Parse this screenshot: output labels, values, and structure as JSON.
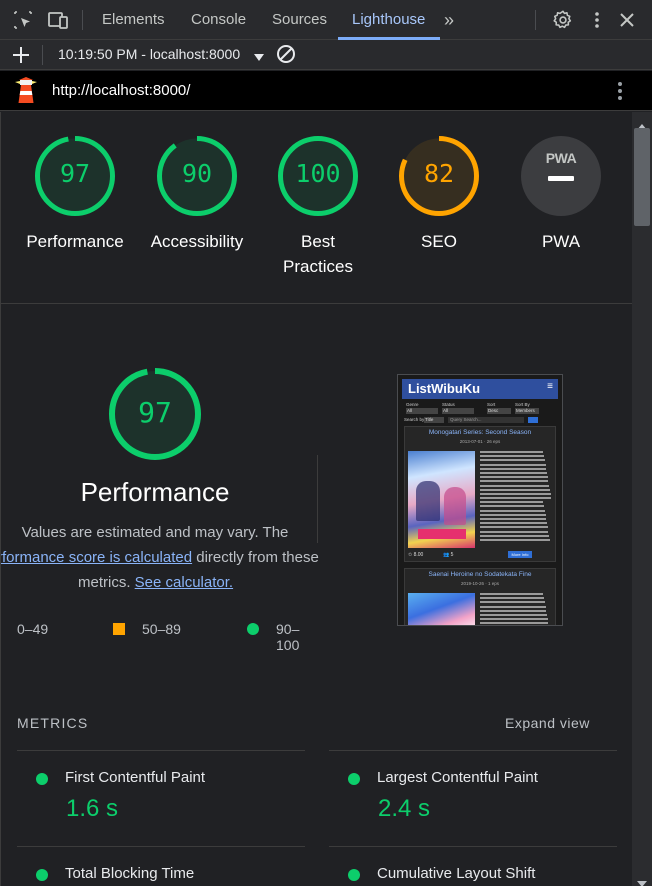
{
  "devtools": {
    "tabs": [
      {
        "label": "Elements"
      },
      {
        "label": "Console"
      },
      {
        "label": "Sources"
      },
      {
        "label": "Lighthouse"
      }
    ],
    "more_tabs": "»"
  },
  "toolbar": {
    "report_selector": "10:19:50 PM - localhost:8000"
  },
  "urlbar": {
    "url": "http://localhost:8000/"
  },
  "colors": {
    "pass": "#0cce6b",
    "average": "#ffa400",
    "fail": "#ff4e42",
    "accent": "#7cacf8"
  },
  "summary_gauges": [
    {
      "label": "Performance",
      "score": "97",
      "status": "pass"
    },
    {
      "label": "Accessibility",
      "score": "90",
      "status": "pass"
    },
    {
      "label": "Best Practices",
      "score": "100",
      "status": "pass"
    },
    {
      "label": "SEO",
      "score": "82",
      "status": "average"
    },
    {
      "label": "PWA",
      "score": "",
      "status": "pwa"
    }
  ],
  "performance": {
    "score": "97",
    "title": "Performance",
    "desc_line1": "Values are estimated and may vary. The",
    "desc_link1": "rformance score is calculated",
    "desc_mid": " directly from these",
    "desc_line3": "metrics. ",
    "desc_link2": "See calculator.",
    "legend": [
      {
        "range": "0–49"
      },
      {
        "range": "50–89"
      },
      {
        "range": "90–100"
      }
    ]
  },
  "screenshot": {
    "site_title": "ListWibuKu",
    "filters": [
      {
        "label": "Genre",
        "value": "All"
      },
      {
        "label": "Status",
        "value": "All"
      },
      {
        "label": "Sort",
        "value": "Desc"
      },
      {
        "label": "Sort By",
        "value": "Members"
      }
    ],
    "search_by": "Search by",
    "search_by_value": "Title",
    "query_placeholder": "Query Search...",
    "cards": [
      {
        "title": "Monogatari Series: Second Season",
        "meta": "2013-07-01 · 26 eps",
        "rating": "8.00",
        "members": "5",
        "button": "More Info"
      },
      {
        "title": "Saenai Heroine no Sodatekata Fine",
        "meta": "2019-10-26 · 1 eps"
      }
    ]
  },
  "metrics": {
    "heading": "METRICS",
    "expand": "Expand view",
    "items": [
      {
        "title": "First Contentful Paint",
        "value": "1.6 s"
      },
      {
        "title": "Largest Contentful Paint",
        "value": "2.4 s"
      },
      {
        "title": "Total Blocking Time",
        "value": ""
      },
      {
        "title": "Cumulative Layout Shift",
        "value": ""
      }
    ]
  }
}
